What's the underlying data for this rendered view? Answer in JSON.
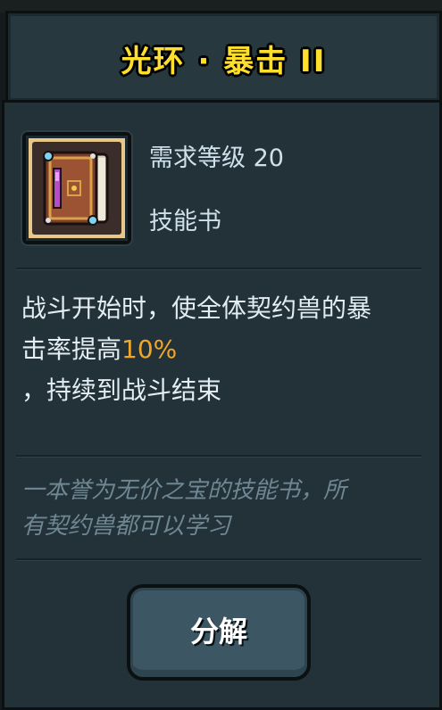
{
  "title": "光环 · 暴击 II",
  "item": {
    "icon": "skill-book-icon",
    "requirement": "需求等级 20",
    "type": "技能书"
  },
  "description": {
    "line1": "战斗开始时，使全体契约兽的暴",
    "line2_prefix": "击率提高",
    "line2_highlight": "10%",
    "line3": "，持续到战斗结束"
  },
  "flavor": {
    "line1": "一本誉为无价之宝的技能书，所",
    "line2": "有契约兽都可以学习"
  },
  "actions": {
    "decompose_label": "分解"
  },
  "colors": {
    "title": "#ffdf2e",
    "highlight": "#f0a62a",
    "panel": "#233139",
    "button": "#3c5663"
  }
}
